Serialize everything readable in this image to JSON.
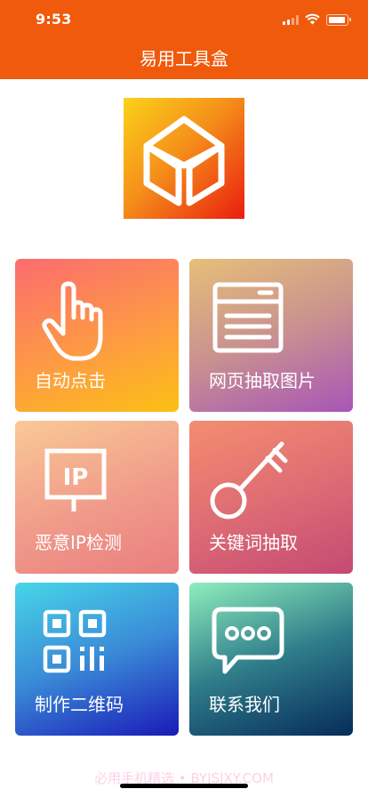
{
  "status_bar": {
    "time": "9:53"
  },
  "header": {
    "title": "易用工具盒"
  },
  "logo": {
    "icon": "cube-icon",
    "colors": [
      "#fcd21b",
      "#f5901a",
      "#ea1d0f"
    ]
  },
  "tiles": [
    {
      "label": "自动点击",
      "icon": "pointer-hand-icon"
    },
    {
      "label": "网页抽取图片",
      "icon": "webpage-icon"
    },
    {
      "label": "恶意IP检测",
      "icon": "ip-sign-icon"
    },
    {
      "label": "关键词抽取",
      "icon": "key-icon"
    },
    {
      "label": "制作二维码",
      "icon": "qr-code-icon"
    },
    {
      "label": "联系我们",
      "icon": "chat-bubble-icon"
    }
  ],
  "watermark": "必用手机精选 • BYJSJXY.COM",
  "colors": {
    "header": "#f05a0d"
  }
}
